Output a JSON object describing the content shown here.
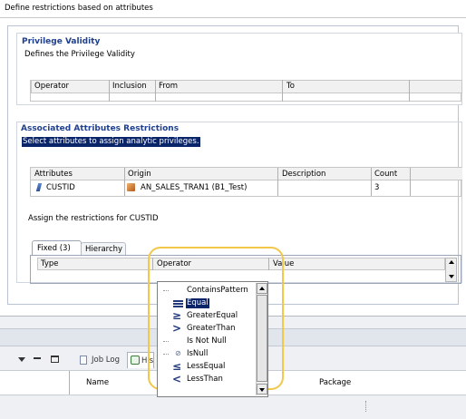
{
  "top_title": "Define restrictions based on attributes",
  "privilege": {
    "title": "Privilege Validity",
    "subtitle": "Defines the Privilege Validity",
    "columns": [
      "Operator",
      "Inclusion",
      "From",
      "To"
    ]
  },
  "associated": {
    "title": "Associated Attributes Restrictions",
    "hint": "Select attributes to assign analytic privileges.",
    "columns": [
      "Attributes",
      "Origin",
      "Description",
      "Count"
    ],
    "row": {
      "attribute": "CUSTID",
      "origin": "AN_SALES_TRAN1 (B1_Test)",
      "description": "",
      "count": "3"
    }
  },
  "restrictions": {
    "label": "Assign the restrictions for CUSTID",
    "tabs": [
      {
        "label": "Fixed (3)",
        "active": true
      },
      {
        "label": "Hierarchy",
        "active": false
      }
    ],
    "columns": [
      "Type",
      "Operator",
      "Value"
    ]
  },
  "operator_dropdown": {
    "selected": "Equal",
    "options": [
      {
        "label": "ContainsPattern",
        "icon": "none"
      },
      {
        "label": "Equal",
        "icon": "equal-icon"
      },
      {
        "label": "GreaterEqual",
        "icon": "greater-equal-icon"
      },
      {
        "label": "GreaterThan",
        "icon": "greater-than-icon"
      },
      {
        "label": "Is Not Null",
        "icon": "none"
      },
      {
        "label": "IsNull",
        "icon": "is-null-icon"
      },
      {
        "label": "LessEqual",
        "icon": "less-equal-icon"
      },
      {
        "label": "LessThan",
        "icon": "less-than-icon"
      }
    ]
  },
  "bottom_panel": {
    "tab_job_log": "Job Log",
    "tab_history": "His",
    "col_name": "Name",
    "col_package": "Package"
  },
  "colors": {
    "header_blue": "#1f3f8f",
    "selection_blue": "#0a246a",
    "highlight_ring": "#f2c84b"
  }
}
